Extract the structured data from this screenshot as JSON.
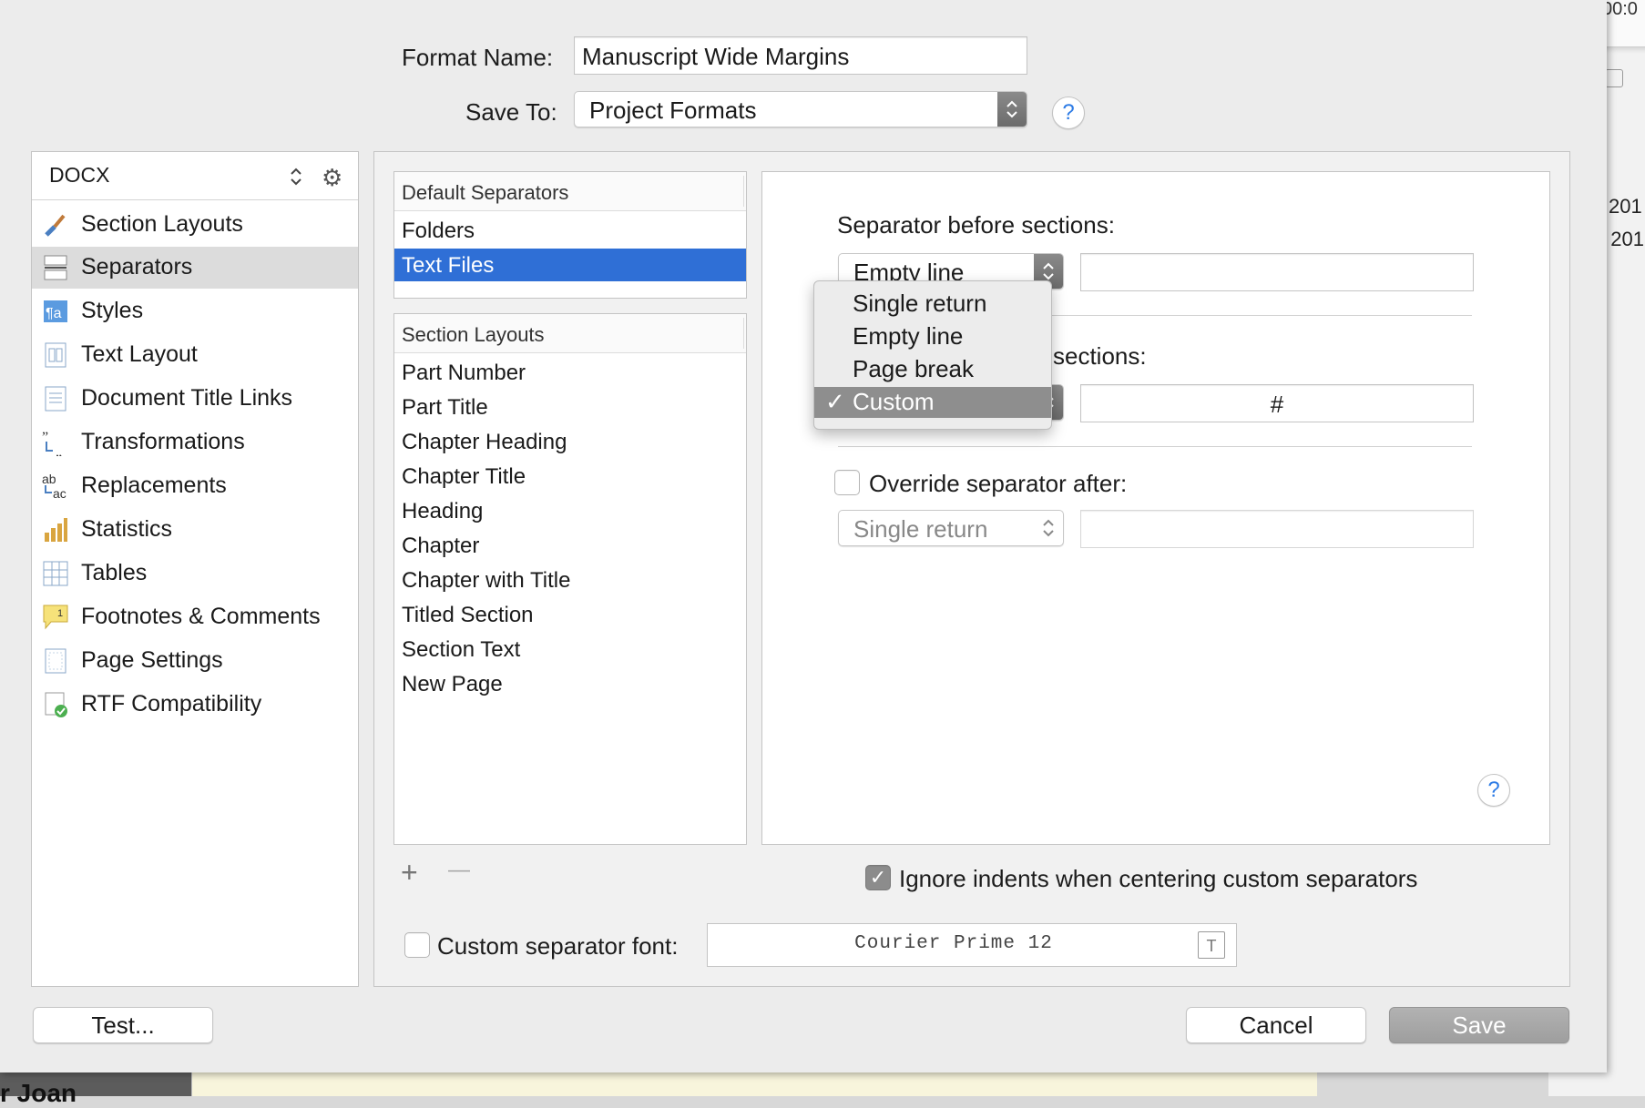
{
  "header": {
    "format_name_label": "Format Name:",
    "format_name_value": "Manuscript Wide Margins",
    "save_to_label": "Save To:",
    "save_to_value": "Project Formats",
    "help": "?"
  },
  "sidebar": {
    "format": "DOCX",
    "items": [
      {
        "label": "Section Layouts",
        "icon": "paintbrush-icon"
      },
      {
        "label": "Separators",
        "icon": "separators-icon"
      },
      {
        "label": "Styles",
        "icon": "styles-icon"
      },
      {
        "label": "Text Layout",
        "icon": "text-layout-icon"
      },
      {
        "label": "Document Title Links",
        "icon": "document-icon"
      },
      {
        "label": "Transformations",
        "icon": "quotes-icon"
      },
      {
        "label": "Replacements",
        "icon": "replacements-icon"
      },
      {
        "label": "Statistics",
        "icon": "bar-chart-icon"
      },
      {
        "label": "Tables",
        "icon": "table-icon"
      },
      {
        "label": "Footnotes & Comments",
        "icon": "footnote-icon"
      },
      {
        "label": "Page Settings",
        "icon": "page-icon"
      },
      {
        "label": "RTF Compatibility",
        "icon": "rtf-check-icon"
      }
    ],
    "icons": {
      "updown": "updown-arrows-icon",
      "gear": "gear-icon"
    }
  },
  "default_separators": {
    "header": "Default Separators",
    "items": [
      "Folders",
      "Text Files"
    ]
  },
  "section_layouts": {
    "header": "Section Layouts",
    "items": [
      "Part Number",
      "Part Title",
      "Chapter Heading",
      "Chapter Title",
      "Heading",
      "Chapter",
      "Chapter with Title",
      "Titled Section",
      "Section Text",
      "New Page"
    ]
  },
  "list_controls": {
    "add": "+",
    "remove": "—"
  },
  "detail": {
    "before_label": "Separator before sections:",
    "before_value": "Empty line",
    "between_label_visible": "sections:",
    "between_custom_text": "#",
    "override_label": "Override separator after:",
    "override_value": "Single return",
    "help": "?"
  },
  "dropdown_menu": {
    "items": [
      "Single return",
      "Empty line",
      "Page break",
      "Custom"
    ],
    "selected": "Custom",
    "check": "✓"
  },
  "ignore_indents_label": "Ignore indents when centering custom separators",
  "custom_font_label": "Custom separator font:",
  "custom_font_value": "Courier Prime 12",
  "buttons": {
    "test": "Test...",
    "cancel": "Cancel",
    "save": "Save"
  },
  "background": {
    "clock": "00:0",
    "year1": "201",
    "year2": ": 201",
    "bottom_text": "r Joan"
  },
  "colors": {
    "selection_blue": "#2f6fd6",
    "help_blue": "#2d7be5"
  }
}
